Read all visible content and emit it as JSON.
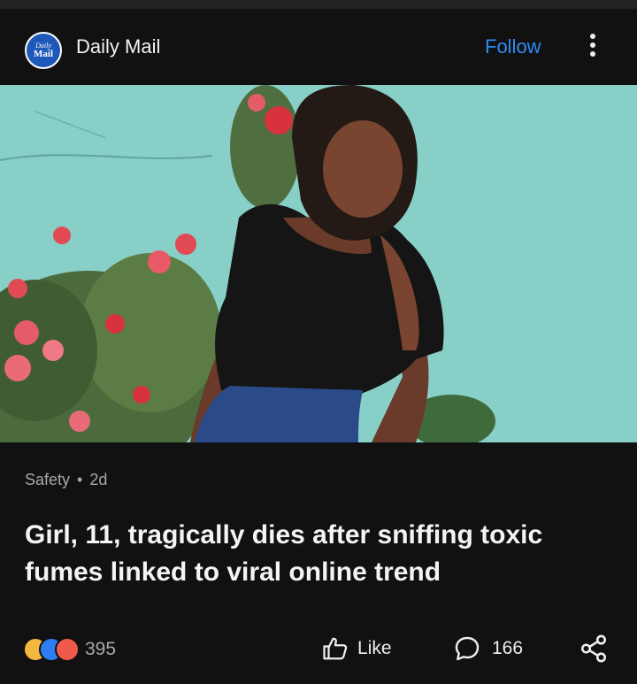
{
  "header": {
    "logo_line1": "Daily",
    "logo_line2": "Mail",
    "source_name": "Daily Mail",
    "follow_label": "Follow",
    "more_icon": "more-vertical-icon"
  },
  "article": {
    "category": "Safety",
    "age": "2d",
    "headline": "Girl, 11, tragically dies after sniffing toxic fumes linked to viral online trend"
  },
  "footer": {
    "reaction_icons": [
      "laugh-reaction-icon",
      "like-reaction-icon",
      "angry-reaction-icon"
    ],
    "reaction_count": "395",
    "like_label": "Like",
    "comment_count": "166",
    "share_icon": "share-icon"
  },
  "colors": {
    "background": "#111111",
    "follow": "#2f8cf3",
    "logo": "#1e58b8",
    "wall": "#8fd4cb"
  }
}
